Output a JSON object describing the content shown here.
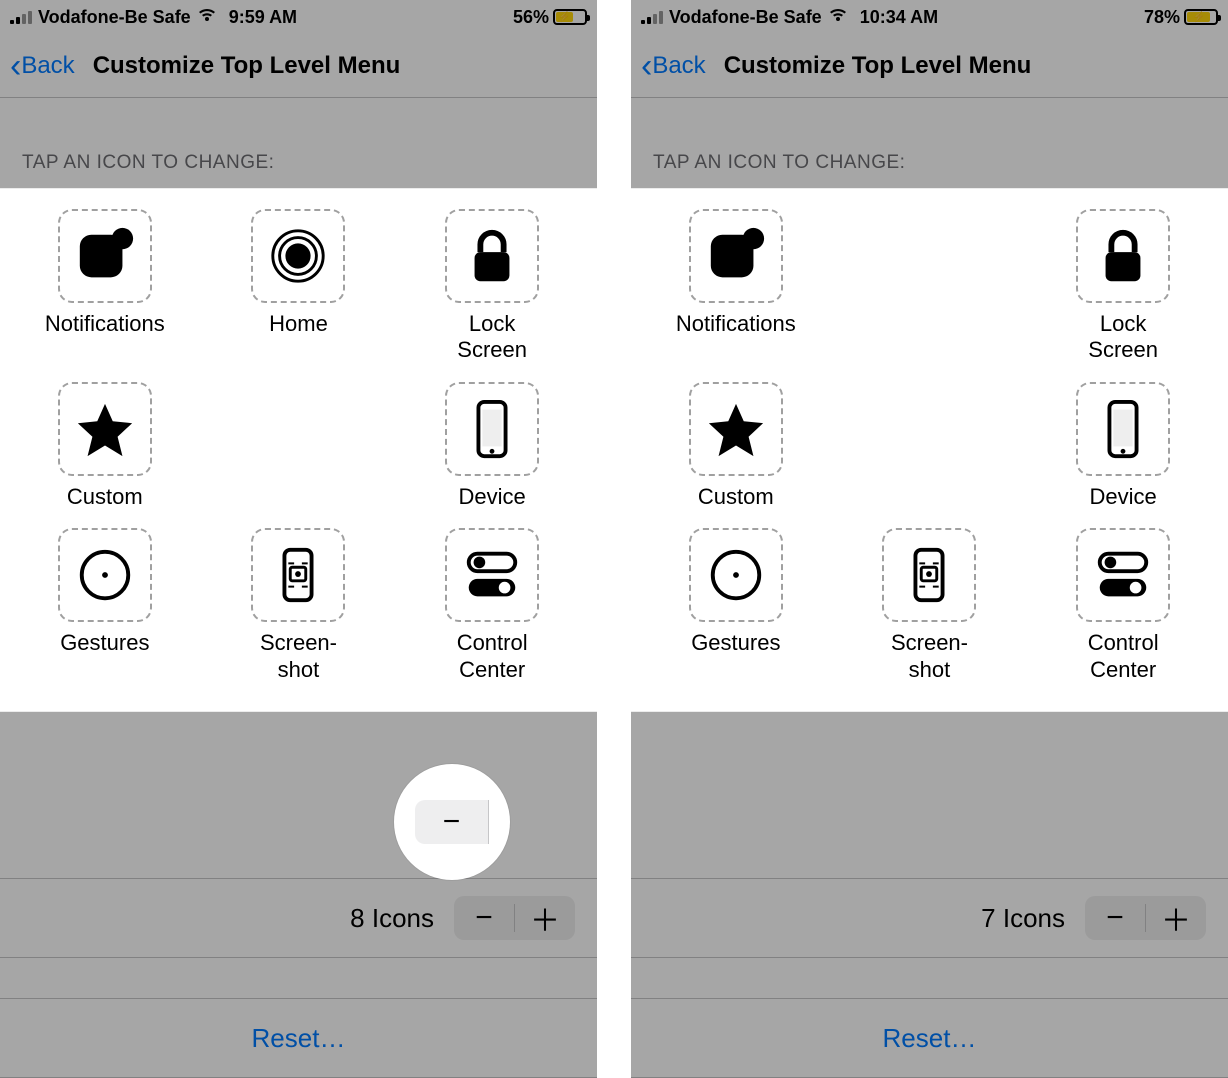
{
  "left": {
    "status": {
      "carrier": "Vodafone-Be Safe",
      "time": "9:59 AM",
      "battery_pct": "56%",
      "battery_fill": 56
    },
    "nav": {
      "back": "Back",
      "title": "Customize Top Level Menu"
    },
    "section_header": "TAP AN ICON TO CHANGE:",
    "grid": [
      {
        "id": "notifications",
        "label": "Notifications"
      },
      {
        "id": "home",
        "label": "Home"
      },
      {
        "id": "lock",
        "label": "Lock\nScreen"
      },
      {
        "id": "custom",
        "label": "Custom"
      },
      {
        "id": "empty"
      },
      {
        "id": "device",
        "label": "Device"
      },
      {
        "id": "gestures",
        "label": "Gestures"
      },
      {
        "id": "screenshot",
        "label": "Screen-\nshot"
      },
      {
        "id": "control",
        "label": "Control\nCenter"
      }
    ],
    "count_label": "8 Icons",
    "reset": "Reset…"
  },
  "right": {
    "status": {
      "carrier": "Vodafone-Be Safe",
      "time": "10:34 AM",
      "battery_pct": "78%",
      "battery_fill": 78
    },
    "nav": {
      "back": "Back",
      "title": "Customize Top Level Menu"
    },
    "section_header": "TAP AN ICON TO CHANGE:",
    "grid": [
      {
        "id": "notifications",
        "label": "Notifications"
      },
      {
        "id": "empty"
      },
      {
        "id": "lock",
        "label": "Lock\nScreen"
      },
      {
        "id": "custom",
        "label": "Custom"
      },
      {
        "id": "empty"
      },
      {
        "id": "device",
        "label": "Device"
      },
      {
        "id": "gestures",
        "label": "Gestures"
      },
      {
        "id": "screenshot",
        "label": "Screen-\nshot"
      },
      {
        "id": "control",
        "label": "Control\nCenter"
      }
    ],
    "count_label": "7 Icons",
    "reset": "Reset…"
  },
  "icons": {
    "notifications": "<svg viewBox='0 0 64 64'><rect x='6' y='10' width='44' height='44' rx='12' fill='#000'/><circle cx='50' cy='14' r='11' fill='#000'/></svg>",
    "home": "<svg viewBox='0 0 64 64'><circle cx='32' cy='32' r='26' fill='none' stroke='#000' stroke-width='3'/><circle cx='32' cy='32' r='19' fill='none' stroke='#000' stroke-width='3'/><circle cx='32' cy='32' r='13' fill='#000'/></svg>",
    "lock": "<svg viewBox='0 0 64 64'><rect x='14' y='28' width='36' height='30' rx='6' fill='#000'/><path d='M20 28 v-8 a12 12 0 0 1 24 0 v8' fill='none' stroke='#000' stroke-width='6'/></svg>",
    "custom": "<svg viewBox='0 0 64 64'><path d='M32 6 L40 24 L60 26 L45 40 L50 60 L32 49 L14 60 L19 40 L4 26 L24 24 Z' fill='#000'/></svg>",
    "device": "<svg viewBox='0 0 64 64'><rect x='18' y='4' width='28' height='56' rx='6' fill='none' stroke='#000' stroke-width='4'/><rect x='22' y='12' width='20' height='38' fill='#eee'/><circle cx='32' cy='55' r='2.5' fill='#000'/></svg>",
    "gestures": "<svg viewBox='0 0 64 64'><circle cx='32' cy='32' r='24' fill='none' stroke='#000' stroke-width='4'/><circle cx='32' cy='32' r='3' fill='#000'/></svg>",
    "screenshot": "<svg viewBox='0 0 64 64'><rect x='18' y='6' width='28' height='52' rx='6' fill='none' stroke='#000' stroke-width='4'/><rect x='24' y='24' width='16' height='14' rx='2' fill='none' stroke='#000' stroke-width='3'/><circle cx='32' cy='31' r='3' fill='#000'/><path d='M22 20 h6 M36 20 h6 M22 44 h6 M36 44 h6' stroke='#000' stroke-width='2'/></svg>",
    "control": "<svg viewBox='0 0 64 64'><rect x='8' y='10' width='48' height='18' rx='9' fill='none' stroke='#000' stroke-width='4'/><circle cx='19' cy='19' r='6' fill='#000'/><rect x='8' y='36' width='48' height='18' rx='9' fill='#000'/><circle cx='45' cy='45' r='6' fill='#fff'/></svg>"
  }
}
